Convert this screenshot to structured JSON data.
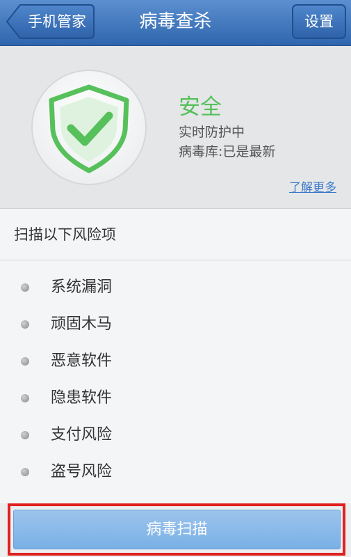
{
  "titlebar": {
    "back_label": "手机管家",
    "title": "病毒查杀",
    "settings_label": "设置"
  },
  "status": {
    "title": "安全",
    "line1": "实时防护中",
    "line2": "病毒库:已是最新",
    "learn_more": "了解更多",
    "icon": "shield-check-icon",
    "accent_color": "#56c05b"
  },
  "scan_section": {
    "header": "扫描以下风险项",
    "items": [
      {
        "label": "系统漏洞"
      },
      {
        "label": "顽固木马"
      },
      {
        "label": "恶意软件"
      },
      {
        "label": "隐患软件"
      },
      {
        "label": "支付风险"
      },
      {
        "label": "盗号风险"
      }
    ]
  },
  "scan_button": {
    "label": "病毒扫描"
  },
  "colors": {
    "titlebar": "#2f66ad",
    "link": "#3b78c8",
    "highlight": "#e02020",
    "button": "#7ab0e6"
  }
}
